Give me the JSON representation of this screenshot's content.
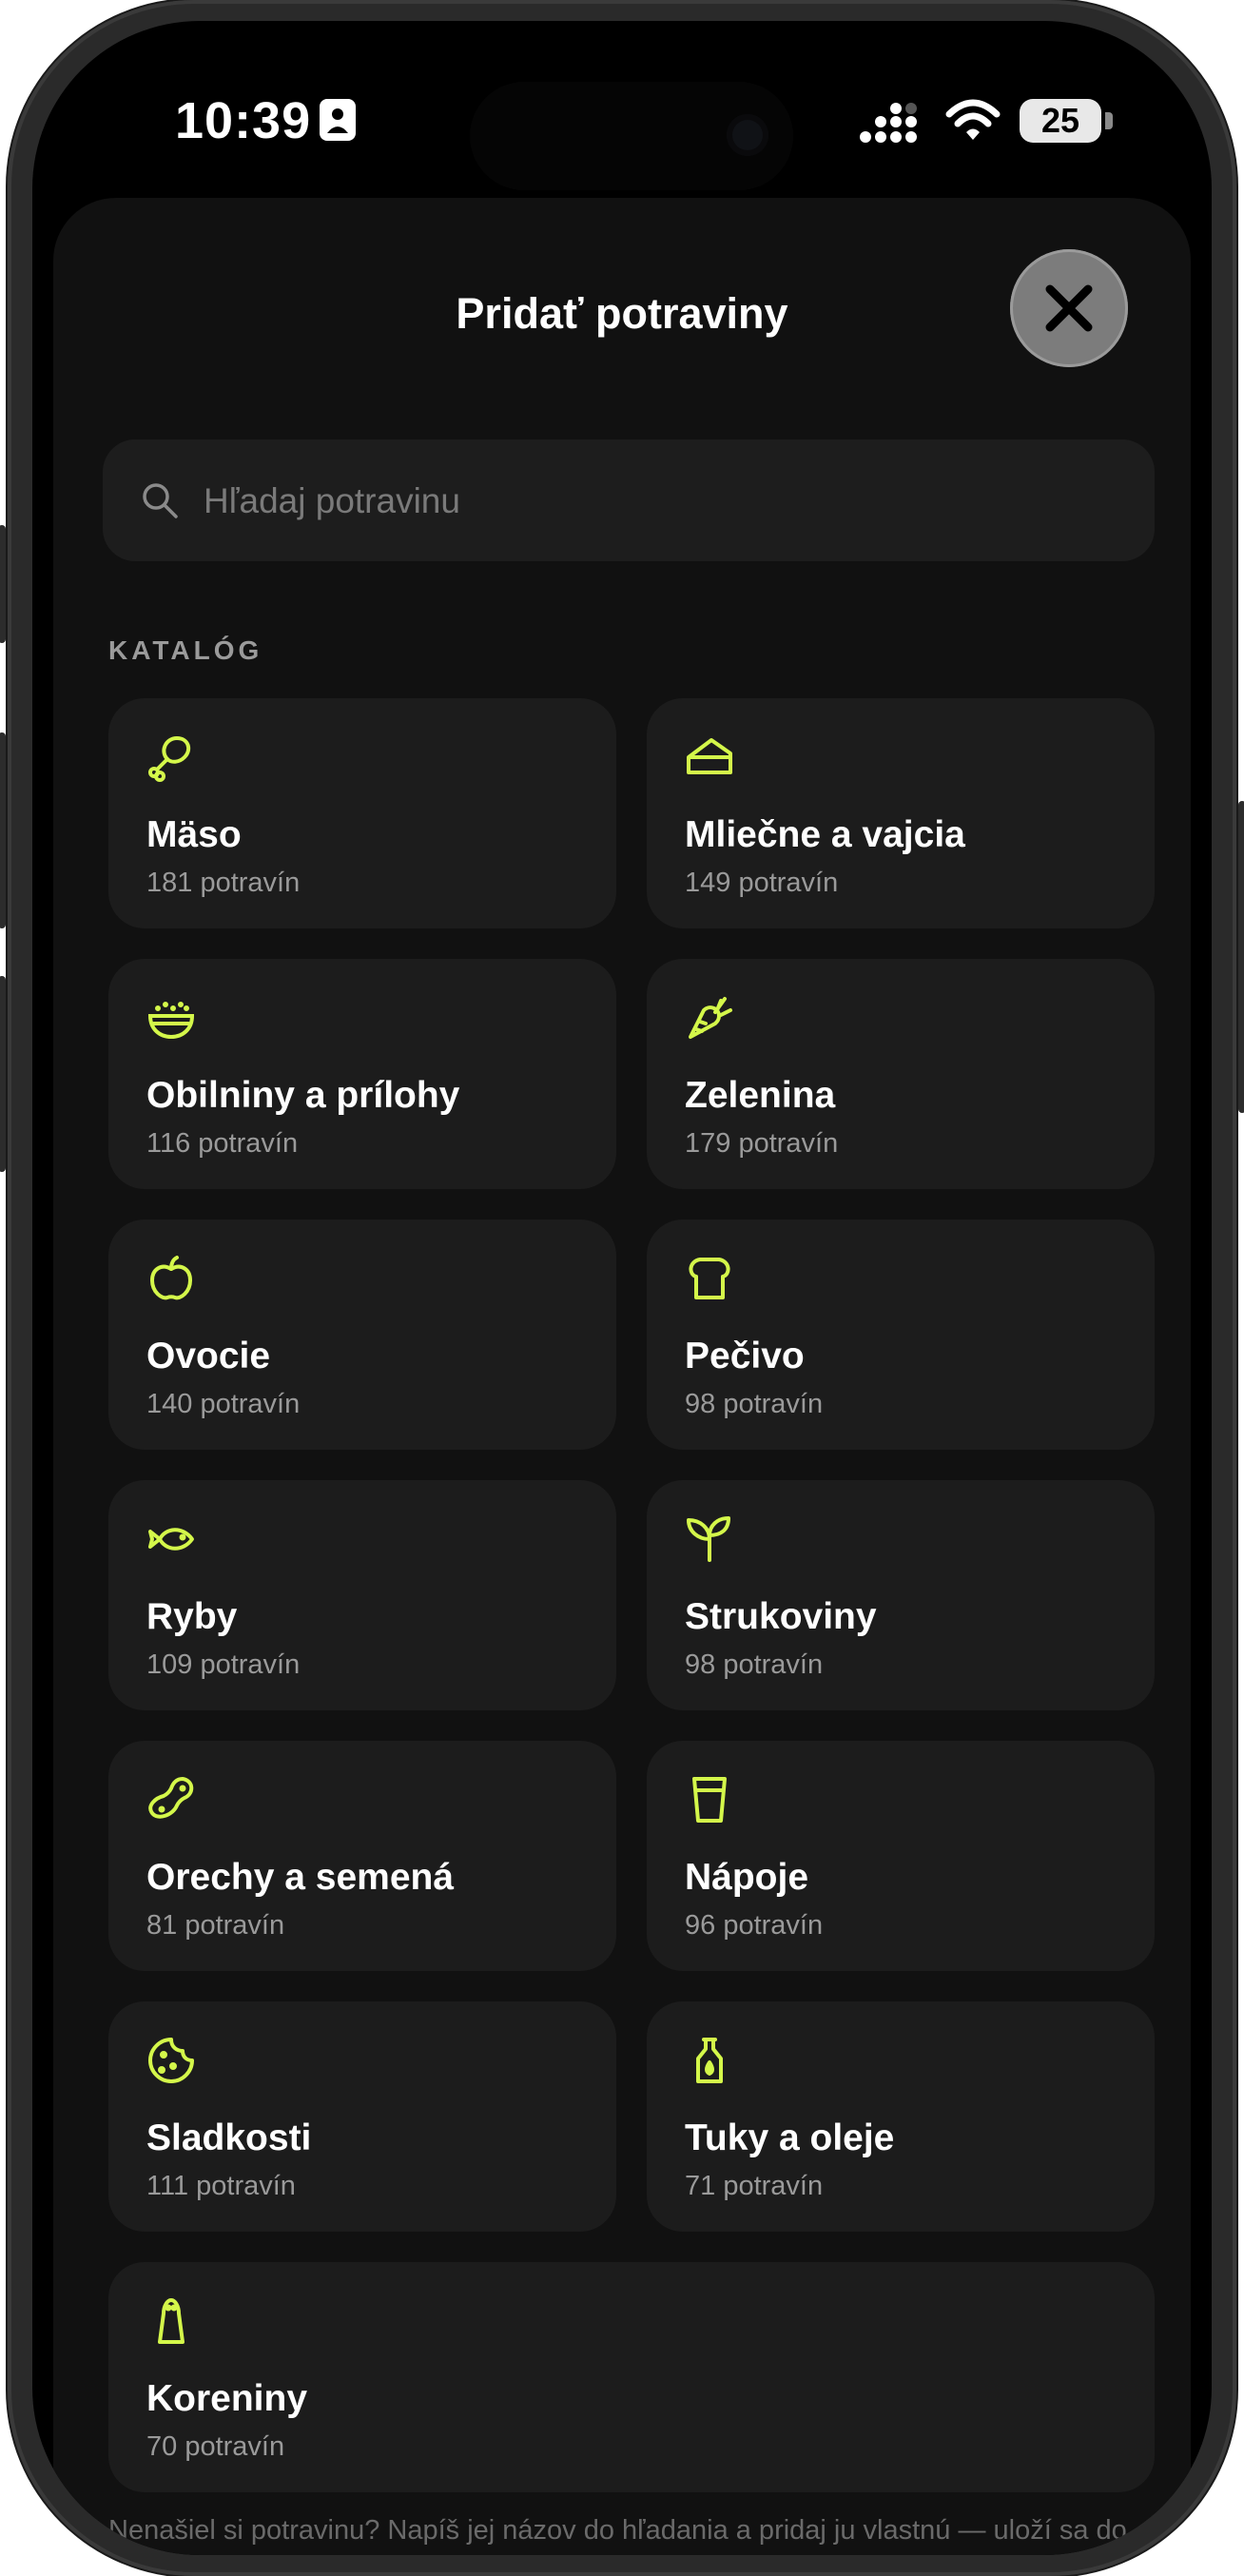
{
  "status_bar": {
    "time": "10:39",
    "battery": "25"
  },
  "sheet": {
    "title": "Pridať potraviny",
    "search_placeholder": "Hľadaj potravinu",
    "section_label": "KATALÓG",
    "hint": "Nenašiel si potravinu? Napíš jej názov do hľadania a pridaj ju vlastnú — uloží sa do"
  },
  "accent_color": "#D4F74A",
  "categories": [
    {
      "name": "Mäso",
      "count": "181 potravín",
      "icon": "drumstick-icon"
    },
    {
      "name": "Mliečne a vajcia",
      "count": "149 potravín",
      "icon": "cheese-icon"
    },
    {
      "name": "Obilniny a prílohy",
      "count": "116 potravín",
      "icon": "rice-bowl-icon"
    },
    {
      "name": "Zelenina",
      "count": "179 potravín",
      "icon": "carrot-icon"
    },
    {
      "name": "Ovocie",
      "count": "140 potravín",
      "icon": "apple-icon"
    },
    {
      "name": "Pečivo",
      "count": "98 potravín",
      "icon": "bread-icon"
    },
    {
      "name": "Ryby",
      "count": "109 potravín",
      "icon": "fish-icon"
    },
    {
      "name": "Strukoviny",
      "count": "98 potravín",
      "icon": "sprout-icon"
    },
    {
      "name": "Orechy a semená",
      "count": "81 potravín",
      "icon": "peanut-icon"
    },
    {
      "name": "Nápoje",
      "count": "96 potravín",
      "icon": "cup-icon"
    },
    {
      "name": "Sladkosti",
      "count": "111 potravín",
      "icon": "cookie-icon"
    },
    {
      "name": "Tuky a oleje",
      "count": "71 potravín",
      "icon": "oil-bottle-icon"
    },
    {
      "name": "Koreniny",
      "count": "70 potravín",
      "icon": "salt-shaker-icon"
    }
  ]
}
